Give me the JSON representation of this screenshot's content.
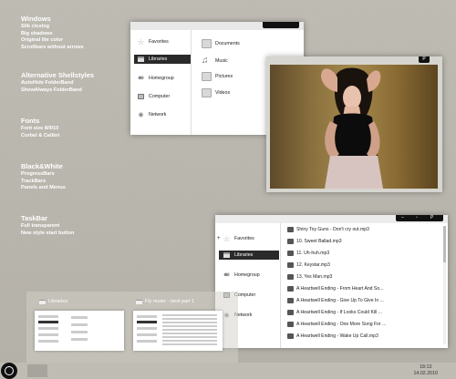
{
  "features": [
    {
      "title": "Windows",
      "items": [
        "Slik closing",
        "Big shadows",
        "Original lite color",
        "Scrollbars without arrows"
      ]
    },
    {
      "title": "Alternative Shellstyles",
      "items": [
        "AutoHide FolderBand",
        "ShowAlways FolderBand"
      ]
    },
    {
      "title": "Fonts",
      "items": [
        "Font size 8/9/10",
        "Corbel & Calibri"
      ]
    },
    {
      "title": "Black&White",
      "items": [
        "ProgressBars",
        "TrackBars",
        "Panels and Menus"
      ]
    },
    {
      "title": "TaskBar",
      "items": [
        "Full transparent",
        "New style start button"
      ]
    }
  ],
  "explorer1": {
    "nav": [
      "Favorites",
      "Libraries",
      "Homegroup",
      "Computer",
      "Network"
    ],
    "libraries": [
      "Documents",
      "Music",
      "Pictures",
      "Videos"
    ]
  },
  "photo_viewer": {
    "button": "P"
  },
  "explorer2": {
    "nav": [
      "Favorites",
      "Libraries",
      "Homegroup",
      "Computer",
      "Network"
    ],
    "songs": [
      "Shiny Toy Guns - Don't cry out.mp3",
      "10. Sweet Ballad.mp3",
      "11. Uh-huh.mp3",
      "12. Keystar.mp3",
      "13. Yes Man.mp3",
      "A Heartwell Ending - From Heart And So...",
      "A Heartwell Ending - Give Up To Give In ...",
      "A Heartwell Ending - If Looks Could Kill ...",
      "A Heartwell Ending - One More Song For ...",
      "A Heartwell Ending - Wake Up Call.mp3"
    ]
  },
  "taskbar": {
    "thumb1_title": "Libraries",
    "thumb2_title": "Fly music - best part 1",
    "time": "18:13",
    "date": "14.02.2010"
  }
}
